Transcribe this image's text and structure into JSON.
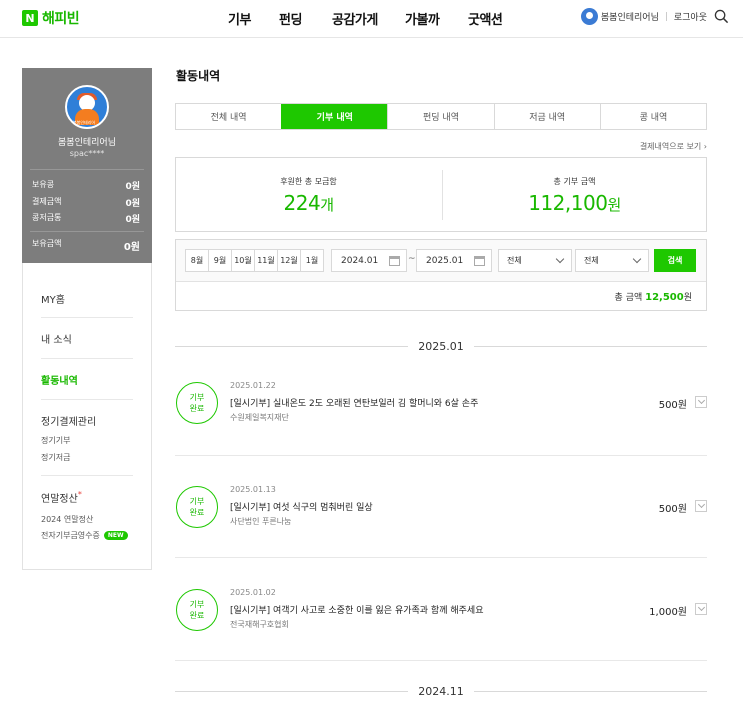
{
  "header": {
    "logo_mark": "N",
    "logo_text": "해피빈",
    "nav": [
      "기부",
      "펀딩",
      "공감가게",
      "가볼까",
      "굿액션"
    ],
    "user_name": "봄봄인테리어님",
    "logout": "로그아웃"
  },
  "profile": {
    "avatar_caption": "봄봄인테리어",
    "name": "봄봄인테리어님",
    "id": "spac****",
    "rows": [
      {
        "label": "보유콩",
        "value": "0원"
      },
      {
        "label": "결제금액",
        "value": "0원"
      },
      {
        "label": "콩저금통",
        "value": "0원"
      }
    ],
    "total_label": "보유금액",
    "total_value": "0원"
  },
  "menu": {
    "my_home": "MY홈",
    "news": "내 소식",
    "activity": "활동내역",
    "regular": "정기결제관리",
    "regular_donation": "정기기부",
    "regular_saving": "정기저금",
    "year_end": "연말정산",
    "year_end_mark": "*",
    "year_end_2024": "2024 연말정산",
    "e_receipt": "전자기부금영수증",
    "new_badge": "NEW"
  },
  "main": {
    "page_title": "활동내역",
    "tabs": [
      "전체 내역",
      "기부 내역",
      "펀딩 내역",
      "저금 내역",
      "콩 내역"
    ],
    "active_tab": 1,
    "receipt_link": "결제내역으로 보기",
    "summary": {
      "left_label": "후원한 총 모금함",
      "left_value": "224",
      "left_unit": "개",
      "right_label": "총 기부 금액",
      "right_value": "112,100",
      "right_unit": "원"
    },
    "filter": {
      "months": [
        "8월",
        "9월",
        "10월",
        "11월",
        "12월",
        "1월"
      ],
      "date_from": "2024.01",
      "tilde": "~",
      "date_to": "2025.01",
      "select1": "전체",
      "select2": "전체",
      "search_button": "검색",
      "total_label": "총 금액",
      "total_value": "12,500",
      "total_unit": "원"
    },
    "groups": [
      {
        "label": "2025.01"
      },
      {
        "label": "2024.11"
      }
    ],
    "items": [
      {
        "badge": "기부\n완료",
        "date": "2025.01.22",
        "title": "[일시기부] 실내온도 2도 오래된 연탄보일러 김 할머니와 6살 손주",
        "org": "수원제일복지재단",
        "amount": "500원"
      },
      {
        "badge": "기부\n완료",
        "date": "2025.01.13",
        "title": "[일시기부] 여섯 식구의 멈춰버린 일상",
        "org": "사단법인 푸른나눔",
        "amount": "500원"
      },
      {
        "badge": "기부\n완료",
        "date": "2025.01.02",
        "title": "[일시기부] 여객기 사고로 소중한 이를 잃은 유가족과 함께 해주세요",
        "org": "전국재해구호협회",
        "amount": "1,000원"
      }
    ]
  },
  "colors": {
    "brand_green": "#1ec800",
    "profile_bg": "#7d7d7d"
  }
}
